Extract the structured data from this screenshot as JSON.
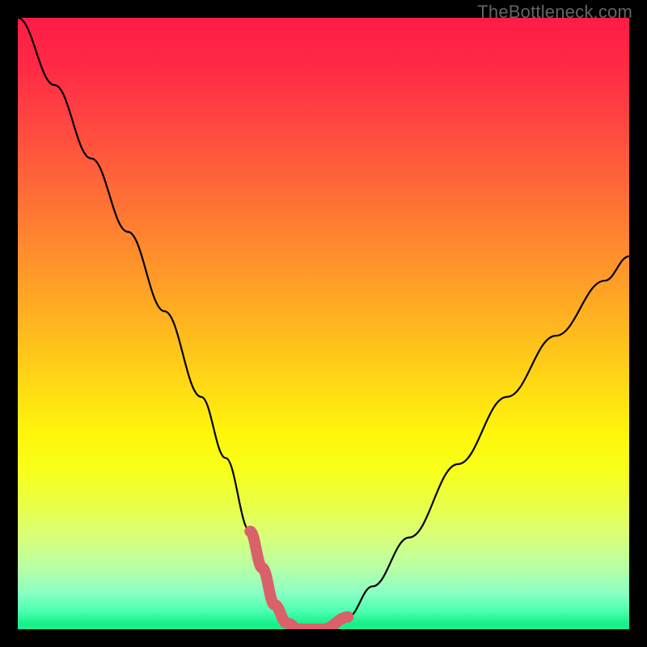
{
  "watermark": "TheBottleneck.com",
  "chart_data": {
    "type": "line",
    "title": "",
    "xlabel": "",
    "ylabel": "",
    "xlim": [
      0,
      100
    ],
    "ylim": [
      0,
      100
    ],
    "grid": false,
    "legend": false,
    "series": [
      {
        "name": "bottleneck-curve",
        "color": "#000000",
        "x": [
          0,
          6,
          12,
          18,
          24,
          30,
          34,
          38,
          40,
          42,
          44,
          46,
          50,
          54,
          58,
          64,
          72,
          80,
          88,
          96,
          100
        ],
        "values": [
          100,
          89,
          77,
          65,
          52,
          38,
          28,
          16,
          10,
          4,
          1,
          0,
          0,
          2,
          7,
          15,
          27,
          38,
          48,
          57,
          61
        ]
      },
      {
        "name": "optimal-band",
        "color": "#d9626a",
        "x": [
          38,
          40,
          42,
          44,
          46,
          50,
          54
        ],
        "values": [
          16,
          10,
          4,
          1,
          0,
          0,
          2
        ]
      }
    ],
    "annotations": []
  }
}
